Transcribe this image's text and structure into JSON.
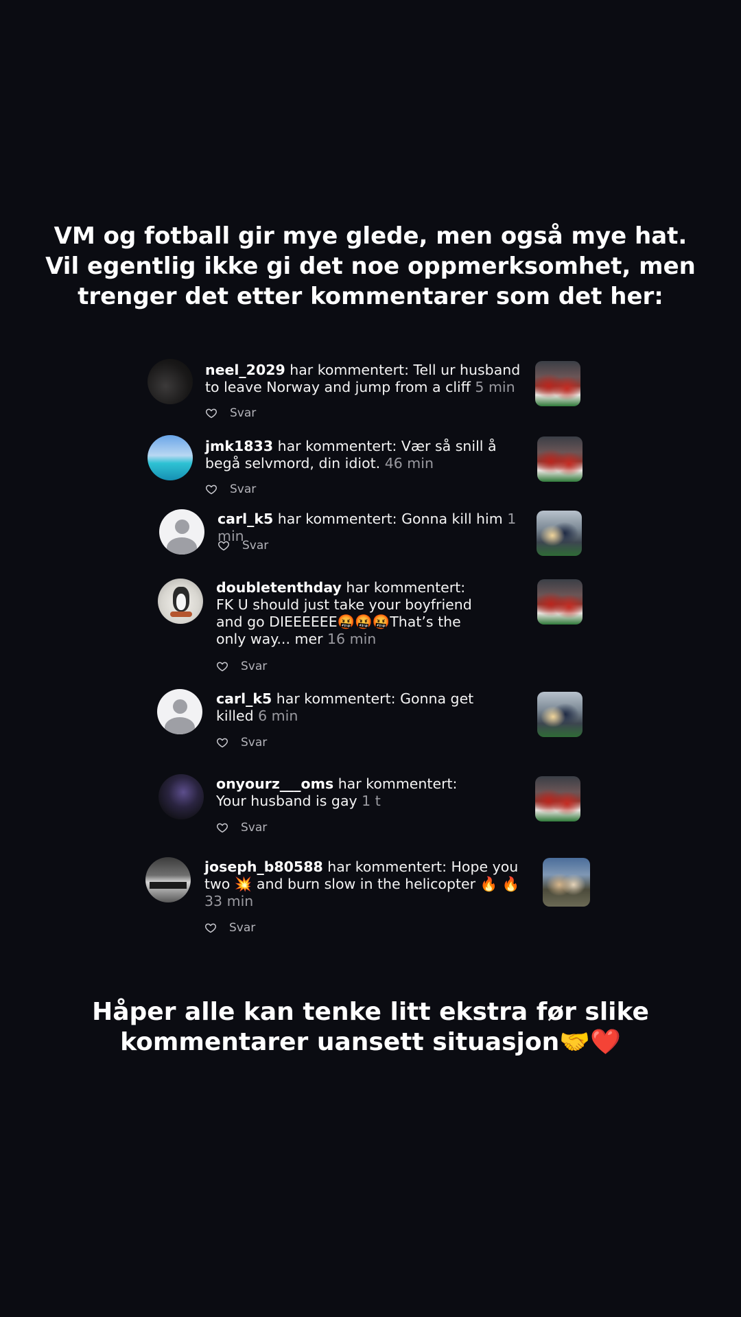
{
  "header": {
    "text": "VM og fotball gir mye glede, men også mye hat. Vil egentlig ikke gi det noe oppmerksomhet, men trenger det etter kommentarer som det her:"
  },
  "comments": [
    {
      "username": "neel_2029",
      "text": " har kommentert: Tell ur husband to leave Norway and jump from a cliff ",
      "time": "5 min",
      "reply_label": "Svar",
      "avatar_icon": "avatar-dark-icon",
      "thumb_icon": "stadium-thumbnail"
    },
    {
      "username": "jmk1833",
      "text": " har kommentert: Vær så snill å begå selvmord, din idiot. ",
      "time": "46 min",
      "reply_label": "Svar",
      "avatar_icon": "avatar-sky-icon",
      "thumb_icon": "stadium-thumbnail"
    },
    {
      "username": "carl_k5",
      "text": " har kommentert: Gonna kill him ",
      "time": "1 min",
      "reply_label": "Svar",
      "avatar_icon": "default-avatar-icon",
      "thumb_icon": "couple-thumbnail"
    },
    {
      "username": "doubletenthday",
      "text": " har kommentert: FK U should just take your boyfriend and go DIEEEEEE🤬🤬🤬That’s the only way... mer ",
      "time": "16 min",
      "reply_label": "Svar",
      "avatar_icon": "avatar-penguin-icon",
      "thumb_icon": "stadium-thumbnail"
    },
    {
      "username": "carl_k5",
      "text": " har kommentert: Gonna get killed ",
      "time": "6 min",
      "reply_label": "Svar",
      "avatar_icon": "default-avatar-icon",
      "thumb_icon": "couple-thumbnail"
    },
    {
      "username": "onyourz___oms",
      "text": " har kommentert: Your husband is gay ",
      "time": "1 t",
      "reply_label": "Svar",
      "avatar_icon": "avatar-purple-icon",
      "thumb_icon": "stadium-thumbnail"
    },
    {
      "username": "joseph_b80588",
      "text": " har kommentert: Hope you two 💥 and burn slow in the helicopter 🔥 🔥 ",
      "time": "33 min",
      "reply_label": "Svar",
      "avatar_icon": "avatar-sign-icon",
      "thumb_icon": "outdoor-thumbnail"
    }
  ],
  "footer": {
    "text": "Håper alle kan tenke litt ekstra før slike kommentarer uansett situasjon🤝❤️"
  },
  "colors": {
    "background": "#0b0c12",
    "text": "#ffffff",
    "muted": "#9a9aa0"
  }
}
